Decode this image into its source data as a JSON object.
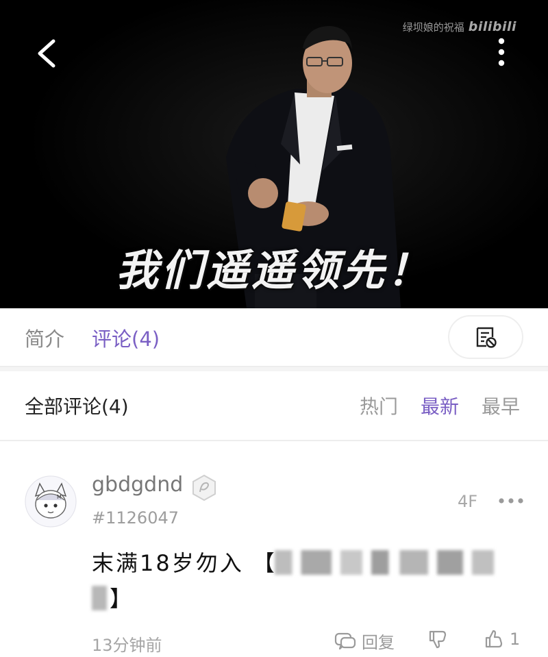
{
  "video": {
    "watermark_text": "绿坝娘的祝福",
    "watermark_logo": "bilibili",
    "subtitle": "我们遥遥领先！"
  },
  "tabs": {
    "intro_label": "简介",
    "comments_label": "评论(4)"
  },
  "comments_header": {
    "all_label": "全部评论(4)",
    "sort_hot": "热门",
    "sort_new": "最新",
    "sort_early": "最早"
  },
  "comment": {
    "username": "gbdgdnd",
    "user_id": "#1126047",
    "floor": "4F",
    "content_prefix": "末满18岁勿入",
    "bracket_open": "【",
    "bracket_close": "】",
    "time": "13分钟前",
    "reply_label": "回复",
    "like_count": "1"
  },
  "colors": {
    "accent": "#7a5fc4",
    "video_bg": "#000000",
    "muted_text": "#9a9a9a"
  },
  "icons": [
    "back-arrow-icon",
    "more-vertical-icon",
    "danmaku-settings-icon",
    "badge-icon",
    "more-horizontal-icon",
    "reply-icon",
    "dislike-icon",
    "like-icon"
  ]
}
